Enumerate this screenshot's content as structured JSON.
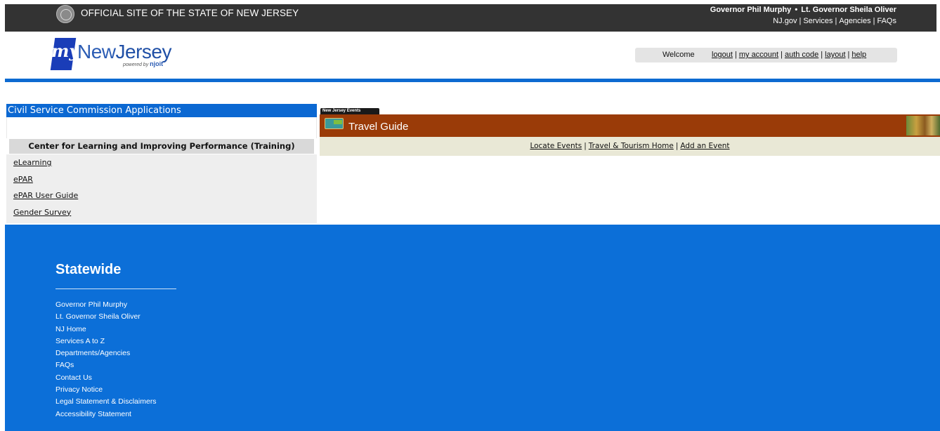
{
  "topbar": {
    "official": "OFFICIAL SITE OF THE STATE OF NEW JERSEY",
    "governor": "Governor Phil Murphy",
    "separator": "•",
    "lt_governor": "Lt. Governor Sheila Oliver",
    "links": [
      "NJ.gov",
      "Services",
      "Agencies",
      "FAQs"
    ],
    "pipe": "|"
  },
  "logo": {
    "my": "my",
    "new": "New",
    "jersey": "Jersey",
    "powered_by": "powered by",
    "njoit": "njoit"
  },
  "account": {
    "welcome": "Welcome",
    "links": [
      "logout",
      "my account",
      "auth code",
      "layout",
      "help"
    ],
    "pipe": "|"
  },
  "left_panel": {
    "title": "Civil Service Commission Applications",
    "section_heading": "Center for Learning and Improving Performance (Training)",
    "items": [
      "eLearning",
      "ePAR",
      "ePAR User Guide",
      "Gender Survey"
    ]
  },
  "events": {
    "tab_label": "New Jersey Events",
    "title": "Travel Guide",
    "links": [
      "Locate Events",
      "Travel & Tourism Home",
      "Add an Event"
    ],
    "pipe": "|"
  },
  "footer": {
    "heading": "Statewide",
    "links": [
      "Governor Phil Murphy",
      "Lt. Governor Sheila Oliver",
      "NJ Home",
      "Services A to Z",
      "Departments/Agencies",
      "FAQs",
      "Contact Us",
      "Privacy Notice",
      "Legal Statement & Disclaimers",
      "Accessibility Statement"
    ]
  },
  "colors": {
    "topbar": "#333333",
    "brand_blue": "#0c6fd8",
    "travel_bar": "#9a3b08",
    "events_links_bg": "#e9e8d6"
  }
}
